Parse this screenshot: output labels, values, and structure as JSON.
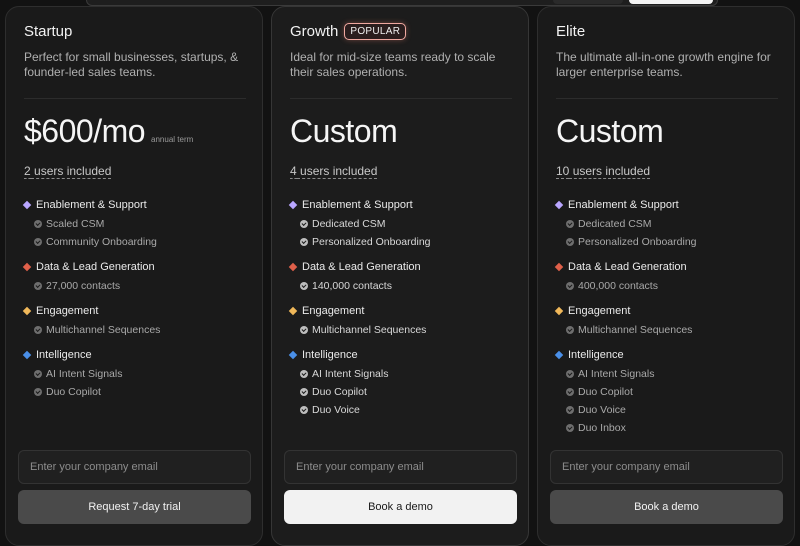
{
  "colors": {
    "enablement": "#b9a6ff",
    "data": "#e0604a",
    "engagement": "#f0b85a",
    "intelligence": "#4a8fe8"
  },
  "plans": [
    {
      "name": "Startup",
      "badge": "",
      "description": "Perfect for small businesses, startups, & founder-led sales teams.",
      "price": "$600/mo",
      "term": "annual term",
      "users_count": "2",
      "users_text": " users included",
      "groups": [
        {
          "title": "Enablement & Support",
          "features": [
            {
              "label": "Scaled CSM",
              "on": false
            },
            {
              "label": "Community Onboarding",
              "on": false
            }
          ]
        },
        {
          "title": "Data & Lead Generation",
          "features": [
            {
              "label": "27,000 contacts",
              "on": false
            }
          ]
        },
        {
          "title": "Engagement",
          "features": [
            {
              "label": "Multichannel Sequences",
              "on": false
            }
          ]
        },
        {
          "title": "Intelligence",
          "features": [
            {
              "label": "AI Intent Signals",
              "on": false
            },
            {
              "label": "Duo Copilot",
              "on": false
            }
          ]
        }
      ],
      "email_placeholder": "Enter your company email",
      "cta": "Request 7-day trial"
    },
    {
      "name": "Growth",
      "badge": "POPULAR",
      "description": "Ideal for mid-size teams ready to scale their sales operations.",
      "price": "Custom",
      "term": "",
      "users_count": "4",
      "users_text": " users included",
      "groups": [
        {
          "title": "Enablement & Support",
          "features": [
            {
              "label": "Dedicated CSM",
              "on": true
            },
            {
              "label": "Personalized Onboarding",
              "on": true
            }
          ]
        },
        {
          "title": "Data & Lead Generation",
          "features": [
            {
              "label": "140,000 contacts",
              "on": true
            }
          ]
        },
        {
          "title": "Engagement",
          "features": [
            {
              "label": "Multichannel Sequences",
              "on": true
            }
          ]
        },
        {
          "title": "Intelligence",
          "features": [
            {
              "label": "AI Intent Signals",
              "on": true
            },
            {
              "label": "Duo Copilot",
              "on": true
            },
            {
              "label": "Duo Voice",
              "on": true
            }
          ]
        }
      ],
      "email_placeholder": "Enter your company email",
      "cta": "Book a demo"
    },
    {
      "name": "Elite",
      "badge": "",
      "description": "The ultimate all-in-one growth engine for larger enterprise teams.",
      "price": "Custom",
      "term": "",
      "users_count": "10",
      "users_text": " users included",
      "groups": [
        {
          "title": "Enablement & Support",
          "features": [
            {
              "label": "Dedicated CSM",
              "on": false
            },
            {
              "label": "Personalized Onboarding",
              "on": false
            }
          ]
        },
        {
          "title": "Data & Lead Generation",
          "features": [
            {
              "label": "400,000 contacts",
              "on": false
            }
          ]
        },
        {
          "title": "Engagement",
          "features": [
            {
              "label": "Multichannel Sequences",
              "on": false
            }
          ]
        },
        {
          "title": "Intelligence",
          "features": [
            {
              "label": "AI Intent Signals",
              "on": false
            },
            {
              "label": "Duo Copilot",
              "on": false
            },
            {
              "label": "Duo Voice",
              "on": false
            },
            {
              "label": "Duo Inbox",
              "on": false
            }
          ]
        }
      ],
      "email_placeholder": "Enter your company email",
      "cta": "Book a demo"
    }
  ]
}
